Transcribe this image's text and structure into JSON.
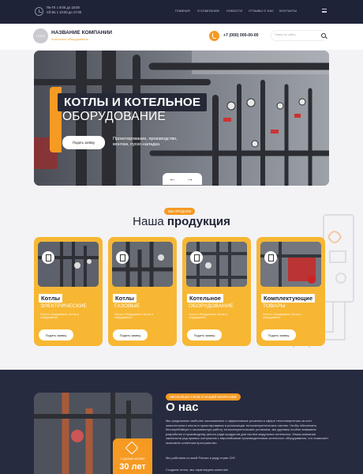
{
  "topbar": {
    "hours_line1": "Пн-Пт с 9:00 до 18:00",
    "hours_line2": "Сб-Вс с 10:00 до 17:00",
    "nav": [
      "Главная",
      "О компании",
      "Новости",
      "Отзывы о нас",
      "Контакты"
    ]
  },
  "header": {
    "logo_text": "LOGO",
    "company_name": "НАЗВАНИЕ КОМПАНИИ",
    "company_sub": "Котельное оборудование",
    "phone": "+7 (000) 000-00-00",
    "search_placeholder": "Поиск по сайту"
  },
  "hero": {
    "title_line1": "КОТЛЫ И КОТЕЛЬНОЕ",
    "title_line2": "ОБОРУДОВАНИЕ",
    "button": "Подать заявку",
    "description": "Проектирование, производство, монтаж, пуско-наладка",
    "arrow_prev": "←",
    "arrow_next": "→"
  },
  "products": {
    "badge": "МЫ ПРОДАЕМ",
    "heading_light": "Наша",
    "heading_bold": "продукция",
    "cards": [
      {
        "title": "Котлы",
        "subtitle": "ЭЛЕКТРИЧЕСКИЕ",
        "desc": "Котлы и оборудование. Котлы и оборудование.",
        "button": "Подать заявку"
      },
      {
        "title": "Котлы",
        "subtitle": "ГАЗОВЫЕ",
        "desc": "Котлы и оборудование. Котлы и оборудование.",
        "button": "Подать заявку"
      },
      {
        "title": "Котельное",
        "subtitle": "ОБОРУДОВАНИЕ",
        "desc": "Котлы и оборудование. Котлы и оборудование.",
        "button": "Подать заявку"
      },
      {
        "title": "Комплектующие",
        "subtitle": "ТОВАРЫ",
        "desc": "Котлы и оборудование. Котлы и оборудование.",
        "button": "Подать заявку"
      }
    ]
  },
  "about": {
    "badge": "НЕСКОЛЬКО СЛОВ О НАШЕЙ КОМПАНИИ",
    "heading": "О нас",
    "paragraph1": "Мы предлагаем наиболее экономичные и эффективные решения в сфере теплоэнергетики за счет значительного опыта в проектировании и реализации теплоэнергетических систем. Чтобы обеспечить бесперебойную и экономичную работу теплоэнергетических установок, мы уделяем особое внимание разработке и производству целого ряда продуктов для систем модульных котельных. Наша компания заключила ряд прямых контрактов с европейскими производителями котельного оборудования, что позволяет экономить клиентам пространство.",
    "paragraph2": "Мы работаем по всей России и ряду стран СНГ.",
    "paragraph3": "Создаем тепло, мы гарантируем качество!",
    "exp_label": "С ДНАМИ БОЛЕЕ",
    "exp_value": "30 лет"
  },
  "colors": {
    "accent": "#f59a23",
    "card": "#f7b733",
    "dark": "#272b40"
  }
}
